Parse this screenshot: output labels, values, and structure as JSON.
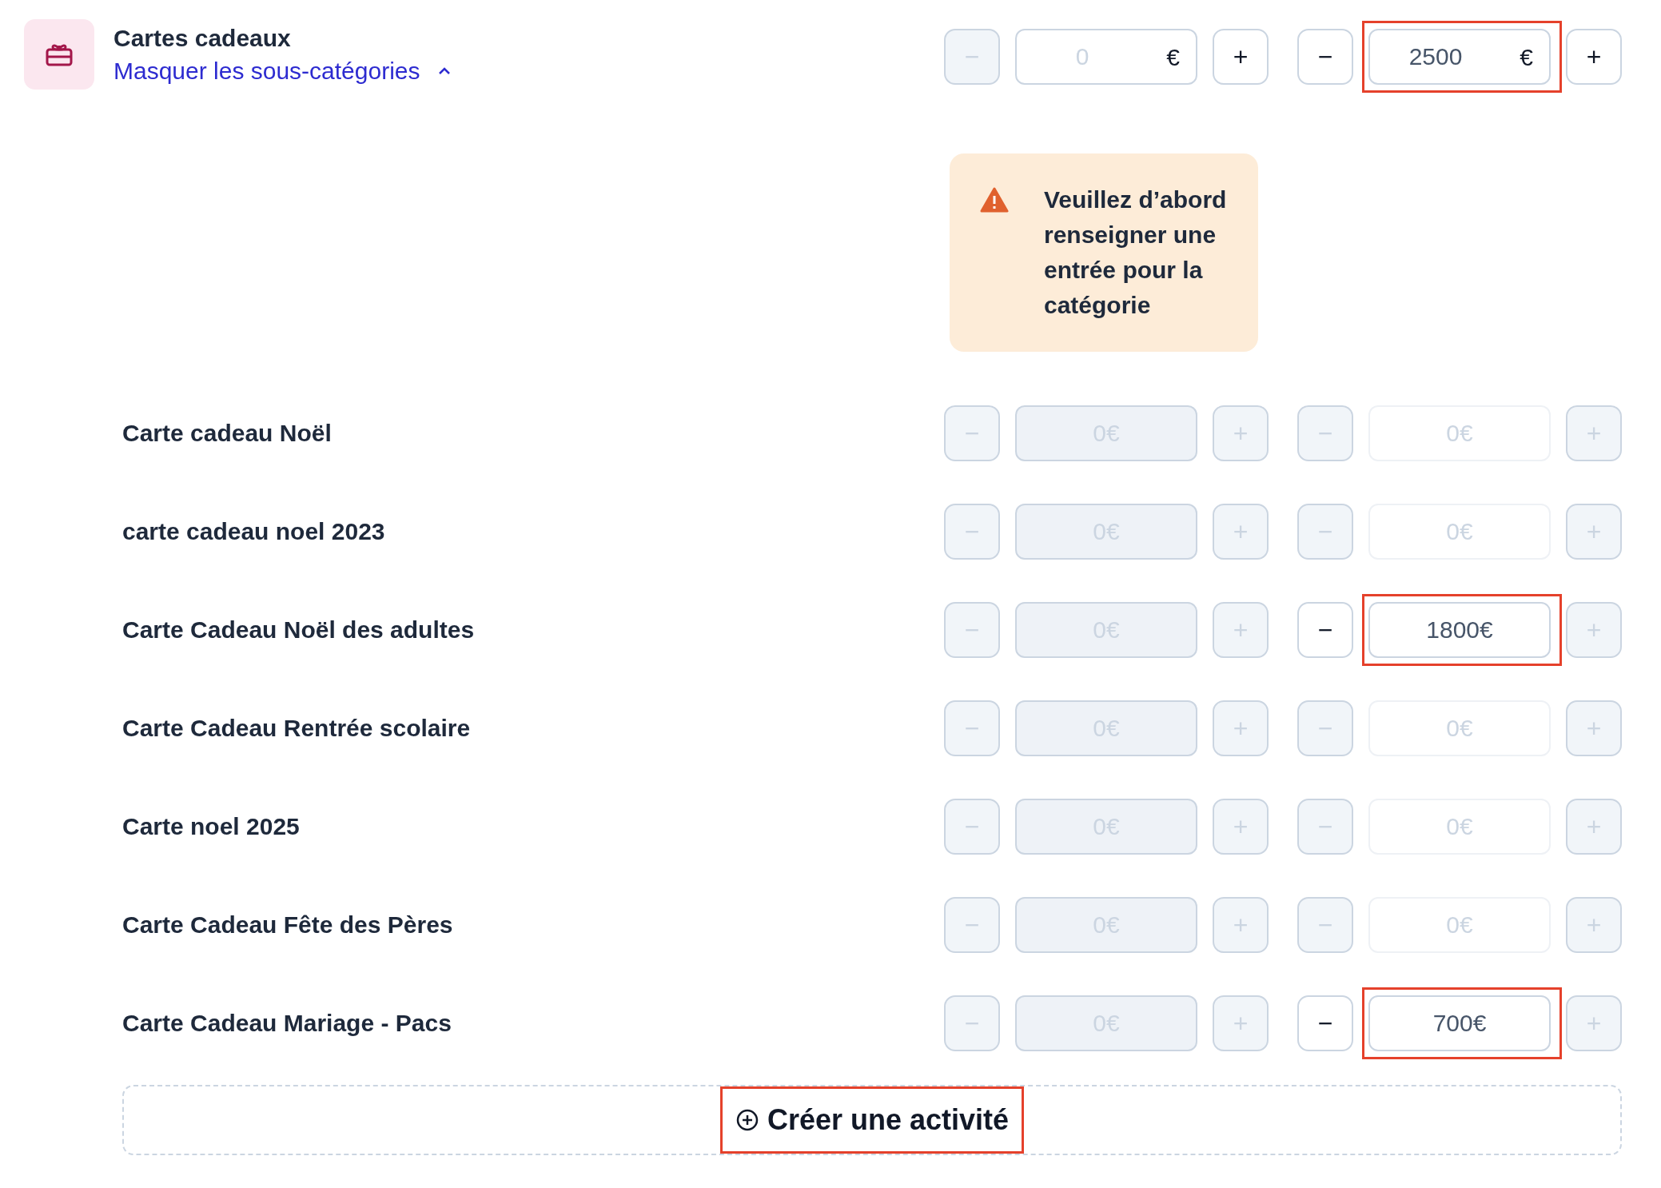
{
  "category": {
    "title": "Cartes cadeaux",
    "toggle_link": "Masquer les sous-catégories",
    "expanded": true,
    "steppers": [
      {
        "minus": "−",
        "plus": "+",
        "placeholder": "0",
        "suffix": "€",
        "disabled": false,
        "minus_disabled": true,
        "plus_disabled": false
      },
      {
        "minus": "−",
        "plus": "+",
        "value": "2500",
        "suffix": "€",
        "disabled": false,
        "minus_disabled": false,
        "plus_disabled": false,
        "highlighted": true
      }
    ]
  },
  "warning": {
    "text": "Veuillez d’abord renseigner une entrée pour la catégorie"
  },
  "subcategories": [
    {
      "name": "Carte cadeau Noël",
      "steppers": [
        {
          "minus": "−",
          "plus": "+",
          "placeholder": "0€",
          "disabled": true,
          "minus_disabled": true,
          "plus_disabled": true
        },
        {
          "minus": "−",
          "plus": "+",
          "placeholder": "0€",
          "disabled": false,
          "minus_disabled": true,
          "plus_disabled": true
        }
      ]
    },
    {
      "name": "carte cadeau noel 2023",
      "steppers": [
        {
          "minus": "−",
          "plus": "+",
          "placeholder": "0€",
          "disabled": true,
          "minus_disabled": true,
          "plus_disabled": true
        },
        {
          "minus": "−",
          "plus": "+",
          "placeholder": "0€",
          "disabled": false,
          "minus_disabled": true,
          "plus_disabled": true
        }
      ]
    },
    {
      "name": "Carte Cadeau Noël des adultes",
      "steppers": [
        {
          "minus": "−",
          "plus": "+",
          "placeholder": "0€",
          "disabled": true,
          "minus_disabled": true,
          "plus_disabled": true
        },
        {
          "minus": "−",
          "plus": "+",
          "value": "1800€",
          "disabled": false,
          "minus_disabled": false,
          "plus_disabled": true,
          "highlighted": true
        }
      ]
    },
    {
      "name": "Carte Cadeau Rentrée scolaire",
      "steppers": [
        {
          "minus": "−",
          "plus": "+",
          "placeholder": "0€",
          "disabled": true,
          "minus_disabled": true,
          "plus_disabled": true
        },
        {
          "minus": "−",
          "plus": "+",
          "placeholder": "0€",
          "disabled": false,
          "minus_disabled": true,
          "plus_disabled": true
        }
      ]
    },
    {
      "name": "Carte noel 2025",
      "steppers": [
        {
          "minus": "−",
          "plus": "+",
          "placeholder": "0€",
          "disabled": true,
          "minus_disabled": true,
          "plus_disabled": true
        },
        {
          "minus": "−",
          "plus": "+",
          "placeholder": "0€",
          "disabled": false,
          "minus_disabled": true,
          "plus_disabled": true
        }
      ]
    },
    {
      "name": "Carte Cadeau Fête des Pères",
      "steppers": [
        {
          "minus": "−",
          "plus": "+",
          "placeholder": "0€",
          "disabled": true,
          "minus_disabled": true,
          "plus_disabled": true
        },
        {
          "minus": "−",
          "plus": "+",
          "placeholder": "0€",
          "disabled": false,
          "minus_disabled": true,
          "plus_disabled": true
        }
      ]
    },
    {
      "name": "Carte Cadeau Mariage - Pacs",
      "steppers": [
        {
          "minus": "−",
          "plus": "+",
          "placeholder": "0€",
          "disabled": true,
          "minus_disabled": true,
          "plus_disabled": true
        },
        {
          "minus": "−",
          "plus": "+",
          "value": "700€",
          "disabled": false,
          "minus_disabled": false,
          "plus_disabled": true,
          "highlighted": true
        }
      ]
    }
  ],
  "create_button": {
    "label": "Créer une activité",
    "highlighted": true
  }
}
